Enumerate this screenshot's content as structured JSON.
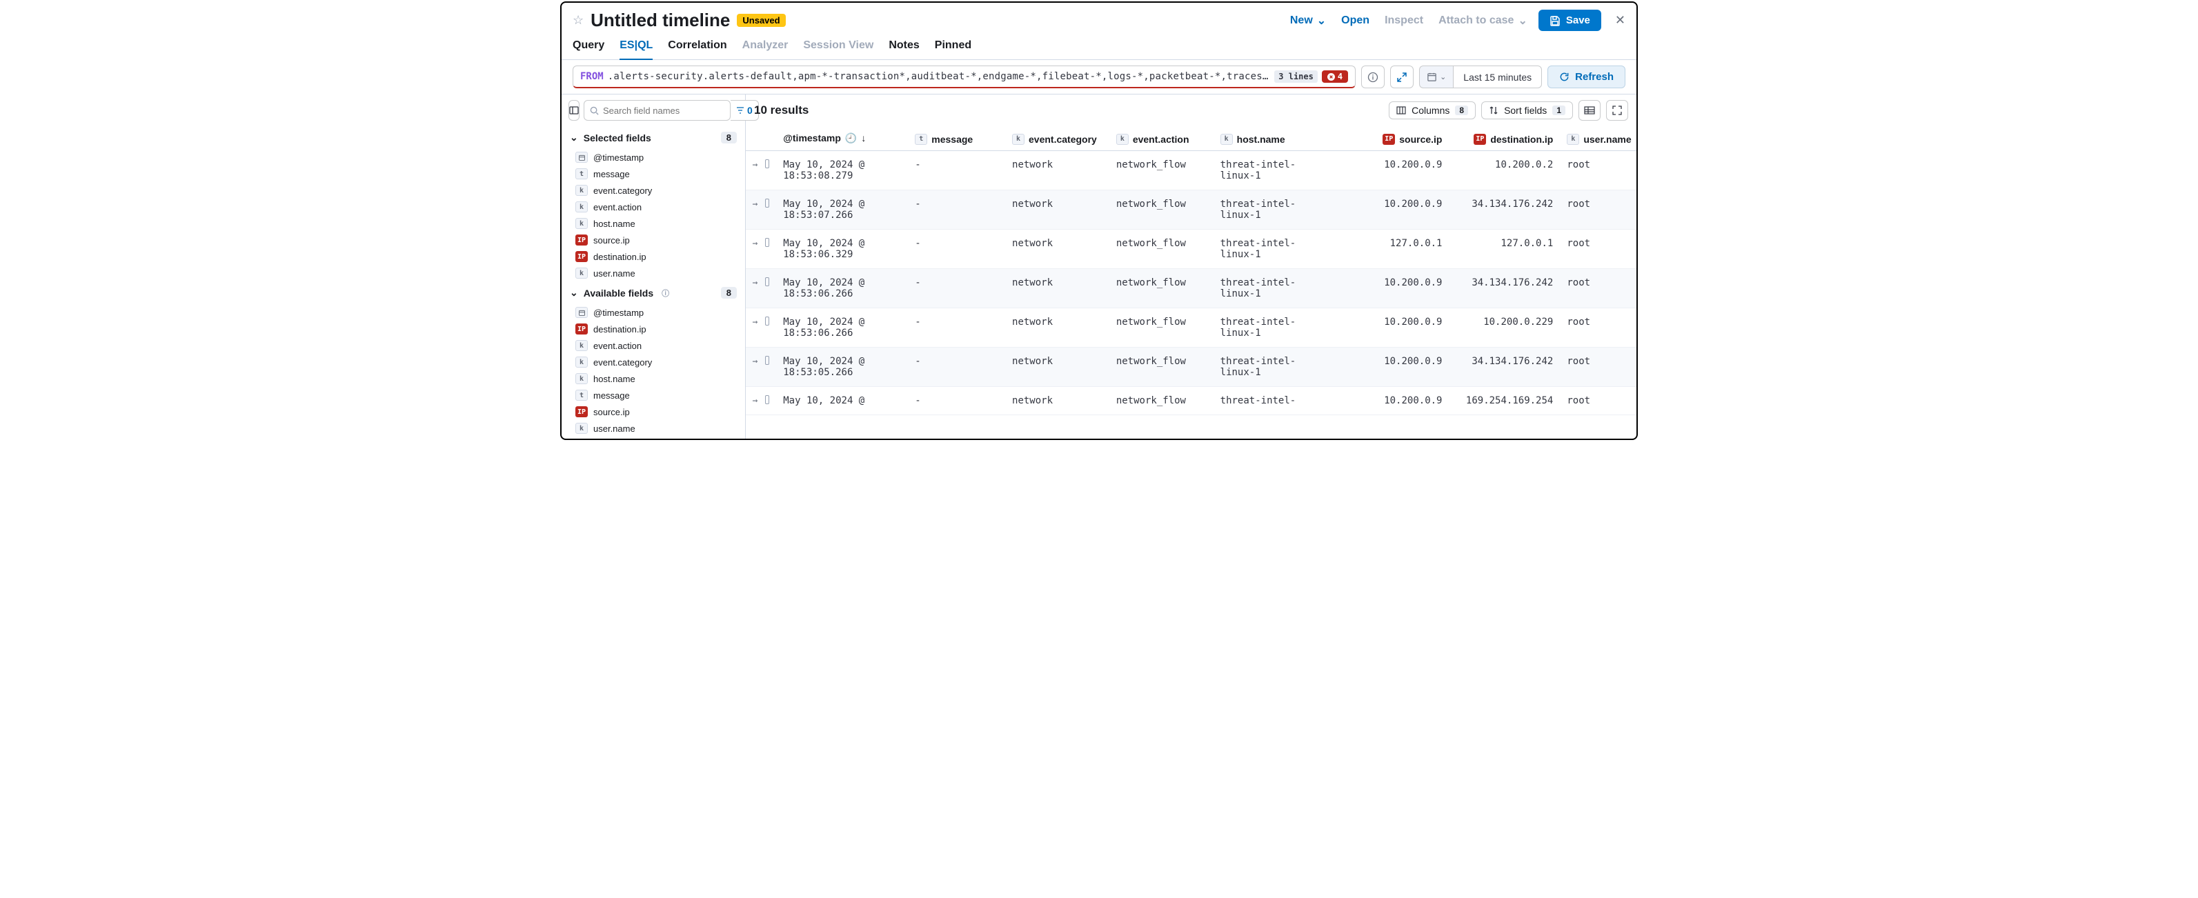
{
  "header": {
    "title": "Untitled timeline",
    "unsaved_badge": "Unsaved",
    "new_label": "New",
    "open_label": "Open",
    "inspect_label": "Inspect",
    "attach_label": "Attach to case",
    "save_label": "Save"
  },
  "tabs": {
    "query": "Query",
    "esql": "ES|QL",
    "correlation": "Correlation",
    "analyzer": "Analyzer",
    "session_view": "Session View",
    "notes": "Notes",
    "pinned": "Pinned"
  },
  "query": {
    "keyword": "FROM",
    "text": ".alerts-security.alerts-default,apm-*-transaction*,auditbeat-*,endgame-*,filebeat-*,logs-*,packetbeat-*,traces-apm*,winlogbeat-*,-*elastic...",
    "lines_badge": "3 lines",
    "error_count": "4",
    "date_range": "Last 15 minutes",
    "refresh_label": "Refresh"
  },
  "sidebar": {
    "search_placeholder": "Search field names",
    "filter_count": "0",
    "selected": {
      "title": "Selected fields",
      "count": "8",
      "items": [
        {
          "type": "date",
          "label": "@timestamp"
        },
        {
          "type": "t",
          "label": "message"
        },
        {
          "type": "k",
          "label": "event.category"
        },
        {
          "type": "k",
          "label": "event.action"
        },
        {
          "type": "k",
          "label": "host.name"
        },
        {
          "type": "ip",
          "label": "source.ip"
        },
        {
          "type": "ip",
          "label": "destination.ip"
        },
        {
          "type": "k",
          "label": "user.name"
        }
      ]
    },
    "available": {
      "title": "Available fields",
      "count": "8",
      "items": [
        {
          "type": "date",
          "label": "@timestamp"
        },
        {
          "type": "ip",
          "label": "destination.ip"
        },
        {
          "type": "k",
          "label": "event.action"
        },
        {
          "type": "k",
          "label": "event.category"
        },
        {
          "type": "k",
          "label": "host.name"
        },
        {
          "type": "t",
          "label": "message"
        },
        {
          "type": "ip",
          "label": "source.ip"
        },
        {
          "type": "k",
          "label": "user.name"
        }
      ]
    }
  },
  "toolbar": {
    "results": "10 results",
    "columns_label": "Columns",
    "columns_count": "8",
    "sort_label": "Sort fields",
    "sort_count": "1"
  },
  "columns": {
    "timestamp": "@timestamp",
    "message": "message",
    "category": "event.category",
    "action": "event.action",
    "host": "host.name",
    "src": "source.ip",
    "dst": "destination.ip",
    "user": "user.name"
  },
  "rows": [
    {
      "ts": "May 10, 2024 @ 18:53:08.279",
      "msg": "-",
      "cat": "network",
      "act": "network_flow",
      "host": "threat-intel-linux-1",
      "src": "10.200.0.9",
      "dst": "10.200.0.2",
      "user": "root"
    },
    {
      "ts": "May 10, 2024 @ 18:53:07.266",
      "msg": "-",
      "cat": "network",
      "act": "network_flow",
      "host": "threat-intel-linux-1",
      "src": "10.200.0.9",
      "dst": "34.134.176.242",
      "user": "root"
    },
    {
      "ts": "May 10, 2024 @ 18:53:06.329",
      "msg": "-",
      "cat": "network",
      "act": "network_flow",
      "host": "threat-intel-linux-1",
      "src": "127.0.0.1",
      "dst": "127.0.0.1",
      "user": "root"
    },
    {
      "ts": "May 10, 2024 @ 18:53:06.266",
      "msg": "-",
      "cat": "network",
      "act": "network_flow",
      "host": "threat-intel-linux-1",
      "src": "10.200.0.9",
      "dst": "34.134.176.242",
      "user": "root"
    },
    {
      "ts": "May 10, 2024 @ 18:53:06.266",
      "msg": "-",
      "cat": "network",
      "act": "network_flow",
      "host": "threat-intel-linux-1",
      "src": "10.200.0.9",
      "dst": "10.200.0.229",
      "user": "root"
    },
    {
      "ts": "May 10, 2024 @ 18:53:05.266",
      "msg": "-",
      "cat": "network",
      "act": "network_flow",
      "host": "threat-intel-linux-1",
      "src": "10.200.0.9",
      "dst": "34.134.176.242",
      "user": "root"
    },
    {
      "ts": "May 10, 2024 @",
      "msg": "-",
      "cat": "network",
      "act": "network_flow",
      "host": "threat-intel-",
      "src": "10.200.0.9",
      "dst": "169.254.169.254",
      "user": "root"
    }
  ]
}
